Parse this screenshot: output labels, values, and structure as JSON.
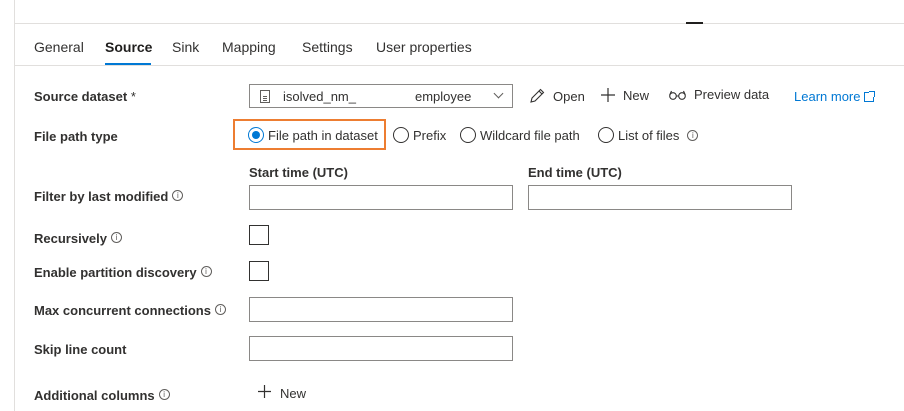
{
  "tabs": [
    {
      "label": "General"
    },
    {
      "label": "Source",
      "active": true
    },
    {
      "label": "Sink"
    },
    {
      "label": "Mapping"
    },
    {
      "label": "Settings"
    },
    {
      "label": "User properties"
    }
  ],
  "source_dataset": {
    "label": "Source dataset",
    "required_mark": "*",
    "value_part1": "isolved_nm_",
    "value_part2": "employee",
    "icon": "file-icon"
  },
  "actions": {
    "open": "Open",
    "new": "New",
    "preview": "Preview data",
    "learn_more": "Learn more"
  },
  "file_path_type": {
    "label": "File path type",
    "options": [
      {
        "label": "File path in dataset",
        "selected": true
      },
      {
        "label": "Prefix",
        "selected": false
      },
      {
        "label": "Wildcard file path",
        "selected": false
      },
      {
        "label": "List of files",
        "selected": false
      }
    ]
  },
  "filter": {
    "label": "Filter by last modified",
    "start_label": "Start time (UTC)",
    "end_label": "End time (UTC)",
    "start_value": "",
    "end_value": ""
  },
  "recursively": {
    "label": "Recursively",
    "checked": false
  },
  "partition_discovery": {
    "label": "Enable partition discovery",
    "checked": false
  },
  "max_connections": {
    "label": "Max concurrent connections",
    "value": ""
  },
  "skip_line_count": {
    "label": "Skip line count",
    "value": ""
  },
  "additional_columns": {
    "label": "Additional columns",
    "add_label": "New"
  },
  "colors": {
    "accent": "#0078d4",
    "highlight": "#ed7d31",
    "text": "#323130",
    "border": "#8a8886"
  }
}
